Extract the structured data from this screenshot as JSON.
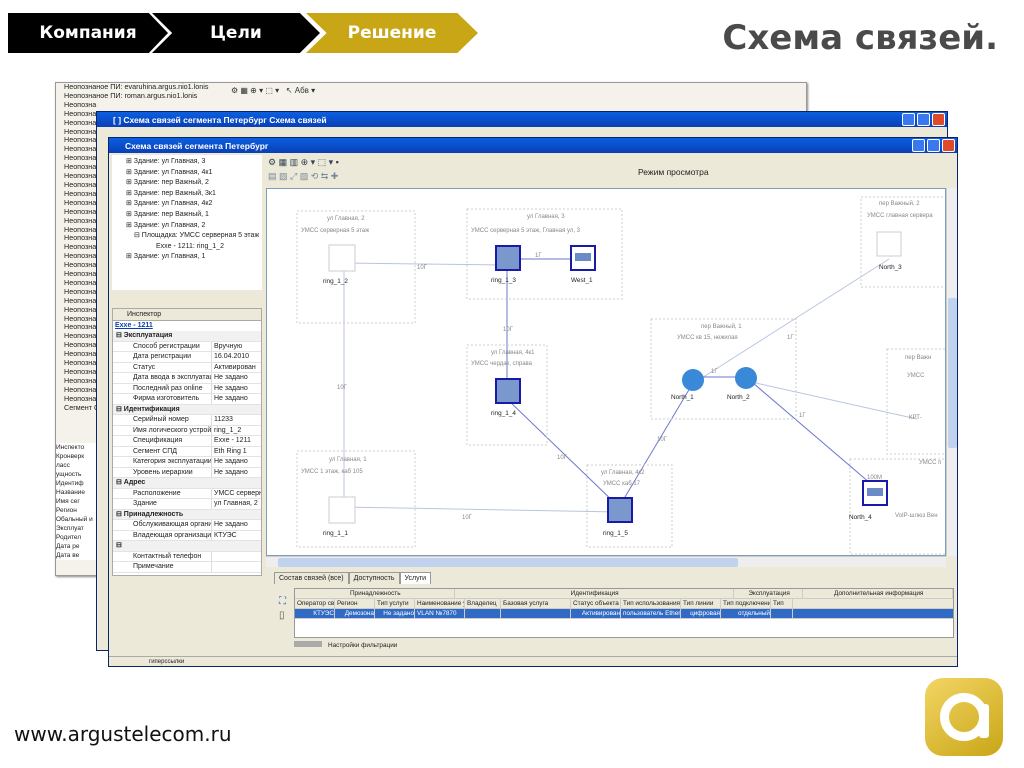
{
  "header": {
    "steps": [
      "Компания",
      "Цели",
      "Решение"
    ],
    "title": "Схема связей."
  },
  "footer": {
    "url": "www.argustelecom.ru"
  },
  "colors": {
    "accent": "#c9a616",
    "dark": "#000000",
    "title_bar": "#0a3fb5",
    "selection": "#316ac5"
  },
  "back_window": {
    "list": [
      "Неопознаное ПИ: evaruhina.argus.nio1.lonis",
      "Неопознаное ПИ: roman.argus.nio1.lonis",
      "Неопозна",
      "Неопозна",
      "Неопозна",
      "Неопозна",
      "Неопозна",
      "Неопозна",
      "Неопозна",
      "Неопозна",
      "Неопозна",
      "Неопозна",
      "Неопозна",
      "Неопозна",
      "Неопозна",
      "Неопозна",
      "Неопозна",
      "Неопозна",
      "Неопозна",
      "Неопозна",
      "Неопозна",
      "Неопозна",
      "Неопозна",
      "Неопозна",
      "Неопозна",
      "Неопозна",
      "Неопозна",
      "Неопозна",
      "Неопозна",
      "Неопозна",
      "Неопозна",
      "Неопозна",
      "Неопозна",
      "Неопозна",
      "Неопозна",
      "Неопозна",
      "Сегмент С"
    ],
    "inspector_partial": [
      "Инспекто",
      "Кронверк",
      "ласс",
      "ущность",
      "Идентиф",
      "Название",
      "Имя сег",
      "Регион",
      "Обальный и",
      "Эксплуат",
      "Родител",
      "Дата ре",
      "Дата ве"
    ],
    "toolbar_text": "Абв"
  },
  "mid_window": {
    "title": "[ ] Схема связей сегмента Петербург Схема связей"
  },
  "front_window": {
    "title": "Схема связей сегмента Петербург",
    "mode": "Режим просмотра",
    "tree": [
      "Здание: ул Главная, 3",
      "Здание: ул Главная, 4к1",
      "Здание: пер Важный, 2",
      "Здание: пер Важный, 3к1",
      "Здание: ул Главная, 4к2",
      "Здание: пер Важный, 1",
      "Здание: ул Главная, 2",
      "Площадка: УМСС серверная 5 этаж",
      "Exxe - 1211: ring_1_2",
      "Здание: ул Главная, 1"
    ],
    "inspector": {
      "title": "Инспектор",
      "name": "Exxe - 1211",
      "rows": [
        {
          "g": "Эксплуатация"
        },
        {
          "k": "Способ регистрации",
          "v": "Вручную"
        },
        {
          "k": "Дата регистрации",
          "v": "16.04.2010"
        },
        {
          "k": "Статус",
          "v": "Активирован"
        },
        {
          "k": "Дата ввода в эксплуатацию",
          "v": "Не задано"
        },
        {
          "k": "Последний раз online",
          "v": "Не задано"
        },
        {
          "k": "Фирма изготовитель",
          "v": "Не задано"
        },
        {
          "g": "Идентификация"
        },
        {
          "k": "Серийный номер",
          "v": "11233"
        },
        {
          "k": "Имя логического устройства",
          "v": "ring_1_2"
        },
        {
          "k": "Спецификация",
          "v": "Exxe - 1211"
        },
        {
          "k": "Сегмент СПД",
          "v": "Eth Ring 1"
        },
        {
          "k": "Категория эксплуатации",
          "v": "Не задано"
        },
        {
          "k": "Уровень иерархии",
          "v": "Не задано"
        },
        {
          "g": "Адрес"
        },
        {
          "k": "Расположение",
          "v": "УМСС серверная"
        },
        {
          "k": "Здание",
          "v": "ул Главная, 2"
        },
        {
          "g": "Принадлежность"
        },
        {
          "k": "Обслуживающая организация",
          "v": "Не задано"
        },
        {
          "k": "Владеющая организация",
          "v": "КТУЭС"
        },
        {
          "g": ""
        },
        {
          "k": "Контактный телефон",
          "v": ""
        },
        {
          "k": "Примечание",
          "v": ""
        }
      ]
    },
    "diagram": {
      "areas": [
        "ул Главная, 2",
        "УМСС серверная 5 этаж",
        "ул Главная, 3",
        "УМСС серверная 5 этаж, Главная ул, 3",
        "ул Главная, 4к1",
        "УМСС чердак, справа",
        "пер Важный, 1",
        "УМСС кв 15, нежилая",
        "ул Главная, 1",
        "УМСС 1 этаж, каб 105",
        "ул Главная, 4к2",
        "УМСС каб 17",
        "пер Важный, 2",
        "УМСС главная сервера",
        "пер Важн",
        "УМСС",
        "УМСС п",
        "VoIP-шлюз Вен",
        "КРТ-"
      ],
      "nodes": [
        "ring_1_2",
        "ring_1_3",
        "West_1",
        "ring_1_4",
        "North_1",
        "North_2",
        "North_3",
        "ring_1_1",
        "ring_1_5",
        "North_4"
      ],
      "links": [
        "10Г",
        "1Г",
        "10Г",
        "10Г",
        "1Г",
        "10Г",
        "10Г",
        "10Г",
        "1Г",
        "1Г",
        "100М"
      ]
    },
    "tabs": [
      "Состав связей (все)",
      "Доступность",
      "Услуги"
    ],
    "grid": {
      "group_headers": [
        "Принадлежность",
        "Идентификация",
        "Эксплуатация",
        "Дополнительная информация"
      ],
      "columns": [
        "Оператор связи",
        "Регион",
        "Тип услуги",
        "Наименование услуги",
        "Владелец",
        "Базовая услуга",
        "Статус объекта",
        "Тип использования",
        "Тип линии",
        "Тип подключения",
        "Тип"
      ],
      "row": [
        "КТУЭС",
        "Демозона",
        "Не задано",
        "VLAN №7870",
        "",
        "",
        "Активирован",
        "пользователь Ethernet",
        "цифровая",
        "отдельный",
        ""
      ]
    },
    "filter_label": "Настройки фильтрации",
    "status": "гиперссылки"
  }
}
